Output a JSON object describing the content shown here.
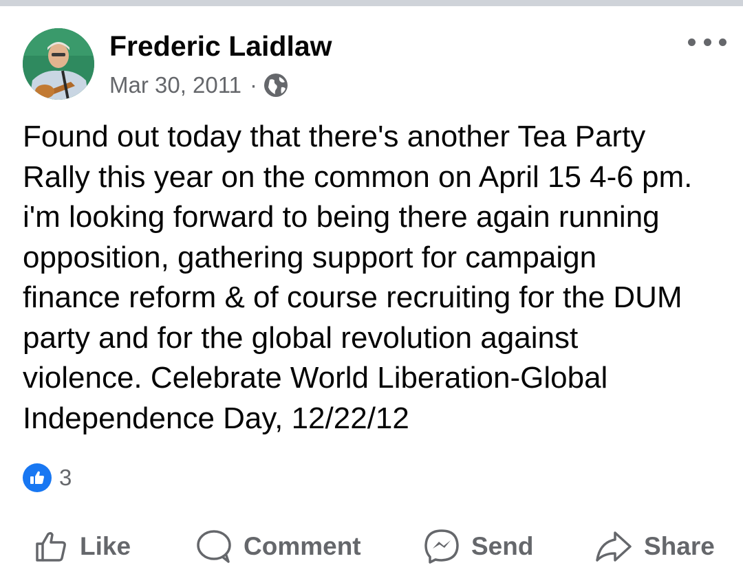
{
  "post": {
    "author": "Frederic Laidlaw",
    "date": "Mar 30, 2011",
    "separator": "·",
    "audience_icon": "globe-icon",
    "more_icon": "more-options-icon",
    "text_lines": [
      "Found out today that there's another Tea Party",
      "Rally this year on the common on April 15 4-6 pm.",
      "i'm looking forward to being there again running",
      "opposition, gathering support for campaign",
      "finance reform & of course recruiting for the DUM",
      "party and for the global revolution against",
      "violence. Celebrate World Liberation-Global",
      "Independence Day, 12/22/12"
    ]
  },
  "reactions": {
    "icon": "like-reaction-icon",
    "count": "3"
  },
  "actions": {
    "like": "Like",
    "comment": "Comment",
    "send": "Send",
    "share": "Share"
  },
  "colors": {
    "accent": "#1877f2",
    "secondary_text": "#65676b",
    "primary_text": "#050505",
    "top_bar": "#cfd3d9"
  }
}
